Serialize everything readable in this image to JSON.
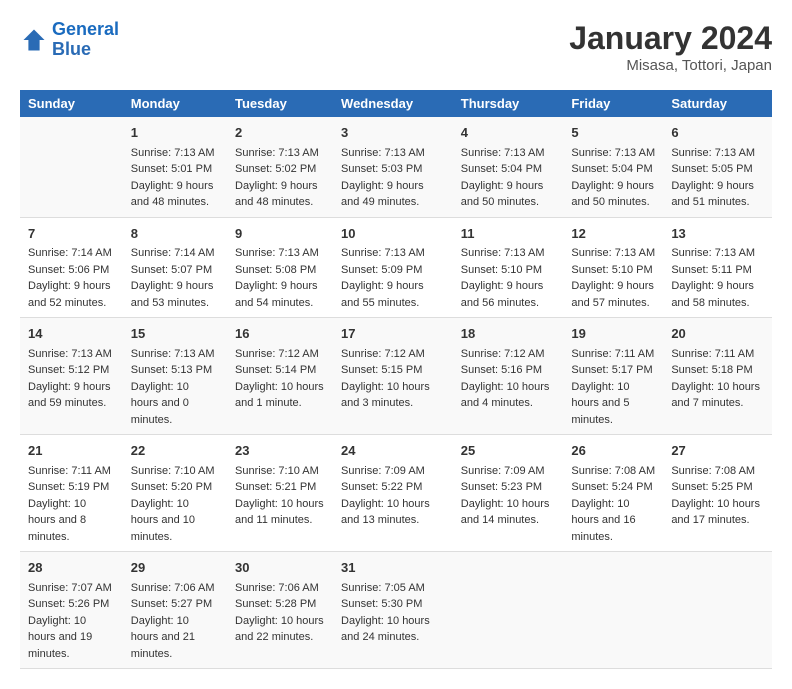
{
  "logo": {
    "line1": "General",
    "line2": "Blue"
  },
  "title": "January 2024",
  "subtitle": "Misasa, Tottori, Japan",
  "days_header": [
    "Sunday",
    "Monday",
    "Tuesday",
    "Wednesday",
    "Thursday",
    "Friday",
    "Saturday"
  ],
  "weeks": [
    [
      {
        "num": "",
        "sunrise": "",
        "sunset": "",
        "daylight": ""
      },
      {
        "num": "1",
        "sunrise": "Sunrise: 7:13 AM",
        "sunset": "Sunset: 5:01 PM",
        "daylight": "Daylight: 9 hours and 48 minutes."
      },
      {
        "num": "2",
        "sunrise": "Sunrise: 7:13 AM",
        "sunset": "Sunset: 5:02 PM",
        "daylight": "Daylight: 9 hours and 48 minutes."
      },
      {
        "num": "3",
        "sunrise": "Sunrise: 7:13 AM",
        "sunset": "Sunset: 5:03 PM",
        "daylight": "Daylight: 9 hours and 49 minutes."
      },
      {
        "num": "4",
        "sunrise": "Sunrise: 7:13 AM",
        "sunset": "Sunset: 5:04 PM",
        "daylight": "Daylight: 9 hours and 50 minutes."
      },
      {
        "num": "5",
        "sunrise": "Sunrise: 7:13 AM",
        "sunset": "Sunset: 5:04 PM",
        "daylight": "Daylight: 9 hours and 50 minutes."
      },
      {
        "num": "6",
        "sunrise": "Sunrise: 7:13 AM",
        "sunset": "Sunset: 5:05 PM",
        "daylight": "Daylight: 9 hours and 51 minutes."
      }
    ],
    [
      {
        "num": "7",
        "sunrise": "Sunrise: 7:14 AM",
        "sunset": "Sunset: 5:06 PM",
        "daylight": "Daylight: 9 hours and 52 minutes."
      },
      {
        "num": "8",
        "sunrise": "Sunrise: 7:14 AM",
        "sunset": "Sunset: 5:07 PM",
        "daylight": "Daylight: 9 hours and 53 minutes."
      },
      {
        "num": "9",
        "sunrise": "Sunrise: 7:13 AM",
        "sunset": "Sunset: 5:08 PM",
        "daylight": "Daylight: 9 hours and 54 minutes."
      },
      {
        "num": "10",
        "sunrise": "Sunrise: 7:13 AM",
        "sunset": "Sunset: 5:09 PM",
        "daylight": "Daylight: 9 hours and 55 minutes."
      },
      {
        "num": "11",
        "sunrise": "Sunrise: 7:13 AM",
        "sunset": "Sunset: 5:10 PM",
        "daylight": "Daylight: 9 hours and 56 minutes."
      },
      {
        "num": "12",
        "sunrise": "Sunrise: 7:13 AM",
        "sunset": "Sunset: 5:10 PM",
        "daylight": "Daylight: 9 hours and 57 minutes."
      },
      {
        "num": "13",
        "sunrise": "Sunrise: 7:13 AM",
        "sunset": "Sunset: 5:11 PM",
        "daylight": "Daylight: 9 hours and 58 minutes."
      }
    ],
    [
      {
        "num": "14",
        "sunrise": "Sunrise: 7:13 AM",
        "sunset": "Sunset: 5:12 PM",
        "daylight": "Daylight: 9 hours and 59 minutes."
      },
      {
        "num": "15",
        "sunrise": "Sunrise: 7:13 AM",
        "sunset": "Sunset: 5:13 PM",
        "daylight": "Daylight: 10 hours and 0 minutes."
      },
      {
        "num": "16",
        "sunrise": "Sunrise: 7:12 AM",
        "sunset": "Sunset: 5:14 PM",
        "daylight": "Daylight: 10 hours and 1 minute."
      },
      {
        "num": "17",
        "sunrise": "Sunrise: 7:12 AM",
        "sunset": "Sunset: 5:15 PM",
        "daylight": "Daylight: 10 hours and 3 minutes."
      },
      {
        "num": "18",
        "sunrise": "Sunrise: 7:12 AM",
        "sunset": "Sunset: 5:16 PM",
        "daylight": "Daylight: 10 hours and 4 minutes."
      },
      {
        "num": "19",
        "sunrise": "Sunrise: 7:11 AM",
        "sunset": "Sunset: 5:17 PM",
        "daylight": "Daylight: 10 hours and 5 minutes."
      },
      {
        "num": "20",
        "sunrise": "Sunrise: 7:11 AM",
        "sunset": "Sunset: 5:18 PM",
        "daylight": "Daylight: 10 hours and 7 minutes."
      }
    ],
    [
      {
        "num": "21",
        "sunrise": "Sunrise: 7:11 AM",
        "sunset": "Sunset: 5:19 PM",
        "daylight": "Daylight: 10 hours and 8 minutes."
      },
      {
        "num": "22",
        "sunrise": "Sunrise: 7:10 AM",
        "sunset": "Sunset: 5:20 PM",
        "daylight": "Daylight: 10 hours and 10 minutes."
      },
      {
        "num": "23",
        "sunrise": "Sunrise: 7:10 AM",
        "sunset": "Sunset: 5:21 PM",
        "daylight": "Daylight: 10 hours and 11 minutes."
      },
      {
        "num": "24",
        "sunrise": "Sunrise: 7:09 AM",
        "sunset": "Sunset: 5:22 PM",
        "daylight": "Daylight: 10 hours and 13 minutes."
      },
      {
        "num": "25",
        "sunrise": "Sunrise: 7:09 AM",
        "sunset": "Sunset: 5:23 PM",
        "daylight": "Daylight: 10 hours and 14 minutes."
      },
      {
        "num": "26",
        "sunrise": "Sunrise: 7:08 AM",
        "sunset": "Sunset: 5:24 PM",
        "daylight": "Daylight: 10 hours and 16 minutes."
      },
      {
        "num": "27",
        "sunrise": "Sunrise: 7:08 AM",
        "sunset": "Sunset: 5:25 PM",
        "daylight": "Daylight: 10 hours and 17 minutes."
      }
    ],
    [
      {
        "num": "28",
        "sunrise": "Sunrise: 7:07 AM",
        "sunset": "Sunset: 5:26 PM",
        "daylight": "Daylight: 10 hours and 19 minutes."
      },
      {
        "num": "29",
        "sunrise": "Sunrise: 7:06 AM",
        "sunset": "Sunset: 5:27 PM",
        "daylight": "Daylight: 10 hours and 21 minutes."
      },
      {
        "num": "30",
        "sunrise": "Sunrise: 7:06 AM",
        "sunset": "Sunset: 5:28 PM",
        "daylight": "Daylight: 10 hours and 22 minutes."
      },
      {
        "num": "31",
        "sunrise": "Sunrise: 7:05 AM",
        "sunset": "Sunset: 5:30 PM",
        "daylight": "Daylight: 10 hours and 24 minutes."
      },
      {
        "num": "",
        "sunrise": "",
        "sunset": "",
        "daylight": ""
      },
      {
        "num": "",
        "sunrise": "",
        "sunset": "",
        "daylight": ""
      },
      {
        "num": "",
        "sunrise": "",
        "sunset": "",
        "daylight": ""
      }
    ]
  ]
}
